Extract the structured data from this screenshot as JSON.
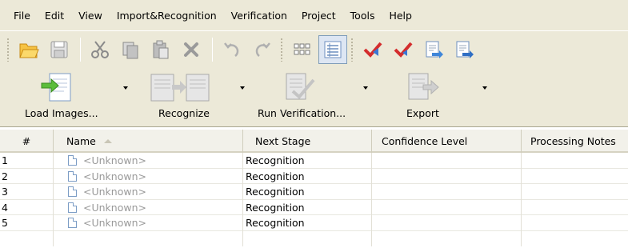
{
  "menu": [
    "File",
    "Edit",
    "View",
    "Import&Recognition",
    "Verification",
    "Project",
    "Tools",
    "Help"
  ],
  "toolbar_icons": [
    "open-folder-icon",
    "save-icon",
    "cut-icon",
    "copy-icon",
    "paste-icon",
    "delete-icon",
    "undo-icon",
    "redo-icon",
    "thumbnails-view-icon",
    "details-view-icon",
    "verify-icon",
    "verify-next-icon",
    "import-icon",
    "export-icon"
  ],
  "big_toolbar": {
    "load_label": "Load Images...",
    "recognize_label": "Recognize",
    "verify_label": "Run Verification...",
    "export_label": "Export"
  },
  "table": {
    "columns": [
      "#",
      "Name",
      "Next Stage",
      "Confidence Level",
      "Processing Notes"
    ],
    "rows": [
      {
        "num": "1",
        "name": "<Unknown>",
        "stage": "Recognition",
        "confidence": "",
        "notes": ""
      },
      {
        "num": "2",
        "name": "<Unknown>",
        "stage": "Recognition",
        "confidence": "",
        "notes": ""
      },
      {
        "num": "3",
        "name": "<Unknown>",
        "stage": "Recognition",
        "confidence": "",
        "notes": ""
      },
      {
        "num": "4",
        "name": "<Unknown>",
        "stage": "Recognition",
        "confidence": "",
        "notes": ""
      },
      {
        "num": "5",
        "name": "<Unknown>",
        "stage": "Recognition",
        "confidence": "",
        "notes": ""
      }
    ]
  },
  "colors": {
    "chrome": "#ece9d8",
    "accent": "#7f9db9",
    "check_red": "#d42d2d"
  }
}
